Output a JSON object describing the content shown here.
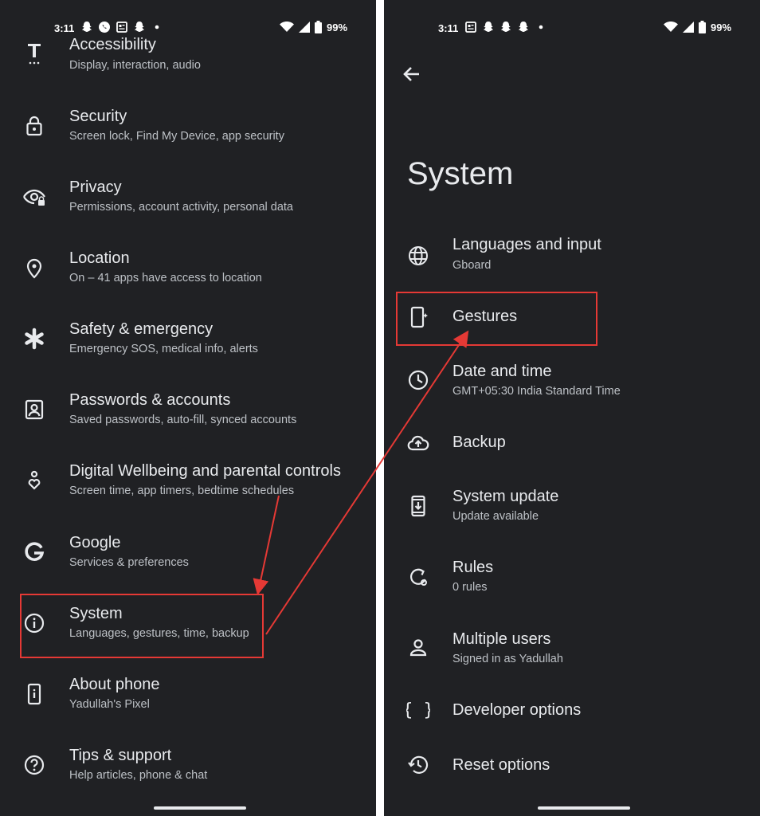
{
  "left": {
    "status": {
      "time": "3:11",
      "battery": "99%"
    },
    "settings": [
      {
        "title": "Accessibility",
        "subtitle": "Display, interaction, audio",
        "icon": "accessibility-icon"
      },
      {
        "title": "Security",
        "subtitle": "Screen lock, Find My Device, app security",
        "icon": "lock-icon"
      },
      {
        "title": "Privacy",
        "subtitle": "Permissions, account activity, personal data",
        "icon": "eye-icon"
      },
      {
        "title": "Location",
        "subtitle": "On – 41 apps have access to location",
        "icon": "location-pin-icon"
      },
      {
        "title": "Safety & emergency",
        "subtitle": "Emergency SOS, medical info, alerts",
        "icon": "asterisk-icon"
      },
      {
        "title": "Passwords & accounts",
        "subtitle": "Saved passwords, auto-fill, synced accounts",
        "icon": "account-box-icon"
      },
      {
        "title": "Digital Wellbeing and parental controls",
        "subtitle": "Screen time, app timers, bedtime schedules",
        "icon": "wellbeing-heart-icon"
      },
      {
        "title": "Google",
        "subtitle": "Services & preferences",
        "icon": "google-g-icon"
      },
      {
        "title": "System",
        "subtitle": "Languages, gestures, time, backup",
        "icon": "info-icon"
      },
      {
        "title": "About phone",
        "subtitle": "Yadullah's Pixel",
        "icon": "phone-info-icon"
      },
      {
        "title": "Tips & support",
        "subtitle": "Help articles, phone & chat",
        "icon": "help-icon"
      }
    ]
  },
  "right": {
    "status": {
      "time": "3:11",
      "battery": "99%"
    },
    "page_title": "System",
    "settings": [
      {
        "title": "Languages and input",
        "subtitle": "Gboard",
        "icon": "globe-icon"
      },
      {
        "title": "Gestures",
        "subtitle": "",
        "icon": "gesture-phone-icon"
      },
      {
        "title": "Date and time",
        "subtitle": "GMT+05:30 India Standard Time",
        "icon": "clock-icon"
      },
      {
        "title": "Backup",
        "subtitle": "",
        "icon": "cloud-upload-icon"
      },
      {
        "title": "System update",
        "subtitle": "Update available",
        "icon": "system-update-icon"
      },
      {
        "title": "Rules",
        "subtitle": "0 rules",
        "icon": "rules-icon"
      },
      {
        "title": "Multiple users",
        "subtitle": "Signed in as Yadullah",
        "icon": "person-icon"
      },
      {
        "title": "Developer options",
        "subtitle": "",
        "icon": "braces-icon"
      },
      {
        "title": "Reset options",
        "subtitle": "",
        "icon": "history-icon"
      }
    ]
  },
  "colors": {
    "background": "#202124",
    "text": "#e8eaed",
    "subtext": "#bdc1c6",
    "highlight": "#e53935"
  }
}
